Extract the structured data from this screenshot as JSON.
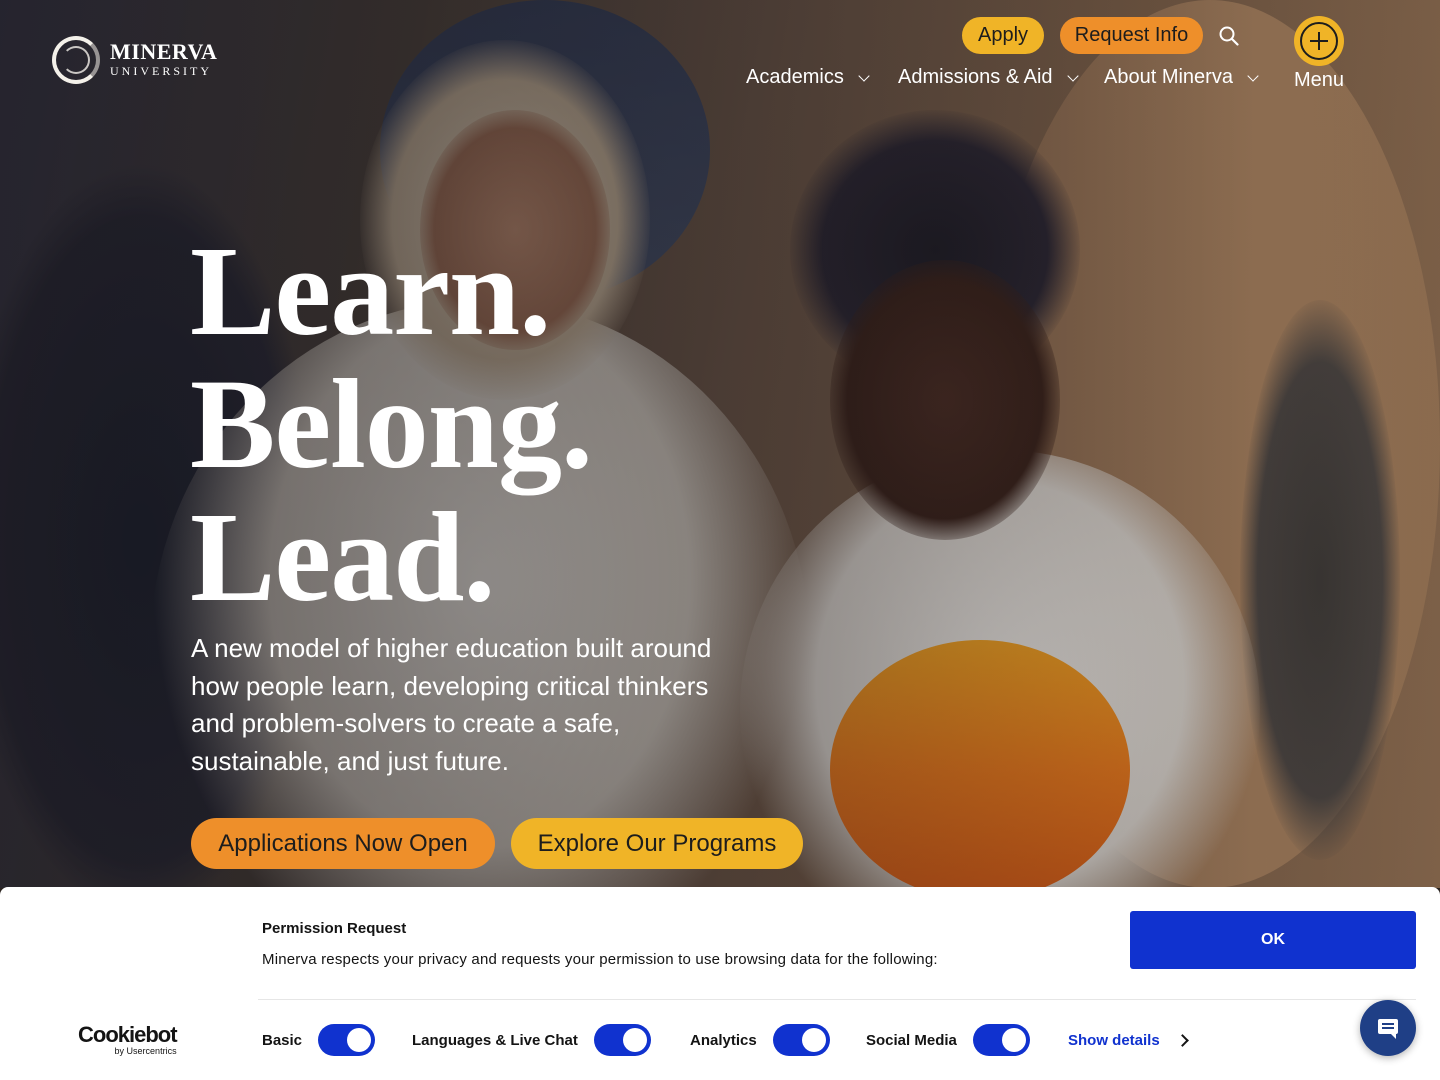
{
  "header": {
    "logo": {
      "name": "MINERVA",
      "sub": "UNIVERSITY"
    },
    "apply_label": "Apply",
    "request_info_label": "Request Info",
    "menu_label": "Menu",
    "nav": [
      {
        "label": "Academics"
      },
      {
        "label": "Admissions & Aid"
      },
      {
        "label": "About Minerva"
      }
    ]
  },
  "hero": {
    "headline": [
      "Learn.",
      "Belong.",
      "Lead."
    ],
    "subtext": "A new model of higher education built around how people learn, developing critical thinkers and problem-solvers to create a safe, sustainable, and just future.",
    "cta_primary": "Applications Now Open",
    "cta_secondary": "Explore Our Programs"
  },
  "cookie_banner": {
    "title": "Permission Request",
    "description": "Minerva respects your privacy and requests your permission to use browsing data for the following:",
    "ok_label": "OK",
    "brand": {
      "name": "Cookiebot",
      "by": "by Usercentrics"
    },
    "toggles": [
      {
        "label": "Basic",
        "enabled": true
      },
      {
        "label": "Languages & Live Chat",
        "enabled": true
      },
      {
        "label": "Analytics",
        "enabled": true
      },
      {
        "label": "Social Media",
        "enabled": true
      }
    ],
    "show_details_label": "Show details"
  },
  "colors": {
    "apply_yellow": "#f0b427",
    "request_orange": "#ee8f2a",
    "cookie_blue": "#1032cf",
    "chat_navy": "#1f3f86"
  },
  "icons": {
    "search": "search-icon",
    "menu": "plus-circle-icon",
    "chat": "chat-icon"
  }
}
